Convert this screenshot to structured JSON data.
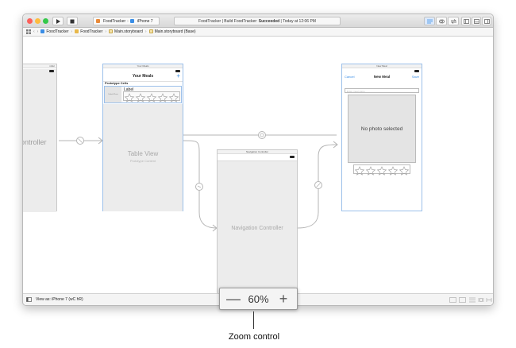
{
  "toolbar": {
    "scheme_target": "FoodTracker",
    "scheme_device": "iPhone 7",
    "activity_project": "FoodTracker",
    "activity_sep1": "|",
    "activity_prefix": "Build FoodTracker:",
    "activity_status": "Succeeded",
    "activity_sep2": "|",
    "activity_time": "Today at 12:06 PM"
  },
  "jumpbar": {
    "items": [
      "FoodTracker",
      "FoodTracker",
      "Main.storyboard",
      "Main.storyboard (Base)"
    ],
    "icon_colors": [
      "#3a8ee6",
      "#e8b84a",
      "#e8b84a",
      "#e8b84a"
    ]
  },
  "scenes": {
    "left_partial": {
      "bar_title": "roller",
      "body_text": "ontroller"
    },
    "your_meals": {
      "bar_title": "Your Meals",
      "nav_title": "Your Meals",
      "add_symbol": "+",
      "prototype_header": "Prototype Cells",
      "cell_label": "Label",
      "cell_thumb_text": "Default Photo",
      "table_view_title": "Table View",
      "table_view_subtitle": "Prototype Content"
    },
    "navigation": {
      "bar_title": "Navigation Controller",
      "body_text": "Navigation Controller"
    },
    "new_meal": {
      "bar_title": "New Meal",
      "cancel": "Cancel",
      "nav_title": "New Meal",
      "save": "Save",
      "text_placeholder": "Enter meal name",
      "photo_text": "No photo selected"
    }
  },
  "bottombar": {
    "view_as": "View as: iPhone 7 (wC hR)"
  },
  "zoom": {
    "minus": "—",
    "level": "60%",
    "plus": "+"
  },
  "callout": {
    "label": "Zoom control"
  },
  "colors": {
    "selection_blue": "#9cc0ea",
    "segue_gray": "#b5b5b5",
    "accent": "#3a8ee6"
  }
}
